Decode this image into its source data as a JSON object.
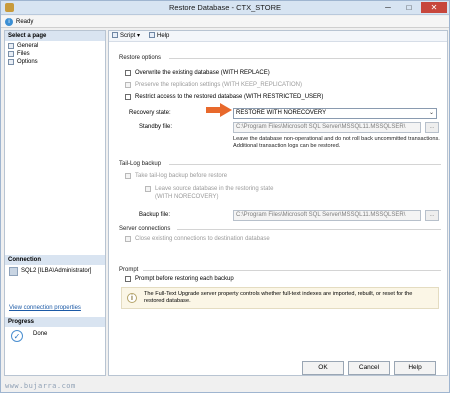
{
  "window": {
    "title": "Restore Database - CTX_STORE",
    "minimize": "─",
    "maximize": "□",
    "close": "✕"
  },
  "status": {
    "ready": "Ready"
  },
  "left": {
    "select_page_header": "Select a page",
    "pages": [
      "General",
      "Files",
      "Options"
    ],
    "connection_header": "Connection",
    "connection_value": "SQL2 [ILBA\\Administrator]",
    "view_connection": "View connection properties",
    "progress_header": "Progress",
    "progress_value": "Done"
  },
  "toolbar": {
    "script": "Script",
    "script_arrow": "▾",
    "help": "Help"
  },
  "restore_options": {
    "header": "Restore options",
    "overwrite": "Overwrite the existing database (WITH REPLACE)",
    "preserve": "Preserve the replication settings (WITH KEEP_REPLICATION)",
    "restrict": "Restrict access to the restored database (WITH RESTRICTED_USER)",
    "recovery_label": "Recovery state:",
    "recovery_value": "RESTORE WITH NORECOVERY",
    "standby_label": "Standby file:",
    "standby_value": "C:\\Program Files\\Microsoft SQL Server\\MSSQL11.MSSQLSER\\",
    "browse": "...",
    "description": "Leave the database non-operational and do not roll back uncommitted transactions. Additional transaction logs can be restored."
  },
  "tail_log": {
    "header": "Tail-Log backup",
    "take_tail": "Take tail-log backup before restore",
    "leave_source_1": "Leave source database in the restoring state",
    "leave_source_2": "(WITH NORECOVERY)",
    "backup_file_label": "Backup file:",
    "backup_file_value": "C:\\Program Files\\Microsoft SQL Server\\MSSQL11.MSSQLSER\\",
    "browse": "..."
  },
  "server_connections": {
    "header": "Server connections",
    "close_existing": "Close existing connections to destination database"
  },
  "prompt": {
    "header": "Prompt",
    "prompt_before": "Prompt before restoring each backup",
    "info": "The Full-Text Upgrade server property controls whether full-text indexes are imported, rebuilt, or reset for the restored database."
  },
  "buttons": {
    "ok": "OK",
    "cancel": "Cancel",
    "help": "Help"
  },
  "watermark": "www.bujarra.com",
  "colors": {
    "arrow": "#e8692c",
    "close_button": "#c7463c",
    "link": "#1c5aa6"
  }
}
